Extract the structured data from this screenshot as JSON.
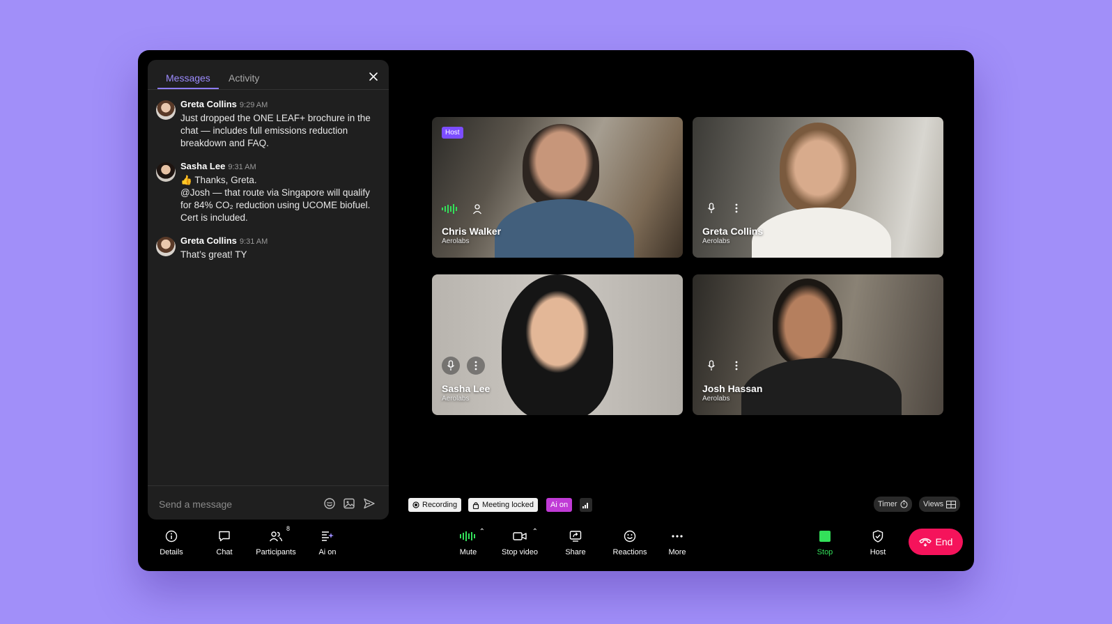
{
  "chat": {
    "tabs": [
      "Messages",
      "Activity"
    ],
    "messages": [
      {
        "author": "Greta Collins",
        "time": "9:29 AM",
        "text": "Just dropped the ONE LEAF+ brochure in the chat — includes full emissions reduction breakdown and FAQ."
      },
      {
        "author": "Sasha Lee",
        "time": "9:31 AM",
        "text": "👍 Thanks, Greta.\n@Josh — that route via Singapore will qualify for 84% CO₂ reduction using UCOME biofuel. Cert is included."
      },
      {
        "author": "Greta Collins",
        "time": "9:31 AM",
        "text": "That’s great! TY"
      }
    ],
    "composer_placeholder": "Send a message"
  },
  "tiles": [
    {
      "name": "Chris Walker",
      "org": "Aerolabs",
      "badge": "Host"
    },
    {
      "name": "Greta Collins",
      "org": "Aerolabs"
    },
    {
      "name": "Sasha Lee",
      "org": "Aerolabs"
    },
    {
      "name": "Josh Hassan",
      "org": "Aerolabs"
    }
  ],
  "status": {
    "recording": "Recording",
    "locked": "Meeting locked",
    "ai": "Ai on",
    "timer": "Timer",
    "views": "Views"
  },
  "toolbar": {
    "left": [
      {
        "label": "Details",
        "icon": "info-icon"
      },
      {
        "label": "Chat",
        "icon": "chat-icon"
      },
      {
        "label": "Participants",
        "icon": "participants-icon",
        "count": "8"
      },
      {
        "label": "Ai on",
        "icon": "ai-icon"
      }
    ],
    "center": [
      {
        "label": "Mute",
        "icon": "audio-level-icon"
      },
      {
        "label": "Stop video",
        "icon": "video-icon"
      },
      {
        "label": "Share",
        "icon": "share-screen-icon"
      },
      {
        "label": "Reactions",
        "icon": "smile-icon"
      },
      {
        "label": "More",
        "icon": "more-icon"
      }
    ],
    "right": [
      {
        "label": "Stop",
        "icon": "stop-icon"
      },
      {
        "label": "Host",
        "icon": "shield-icon"
      }
    ],
    "end_label": "End"
  },
  "colors": {
    "background": "#a18ff9",
    "accent": "#8d7cf5",
    "end": "#f5135b",
    "green": "#33e05a",
    "ai": "#c03bd6"
  }
}
